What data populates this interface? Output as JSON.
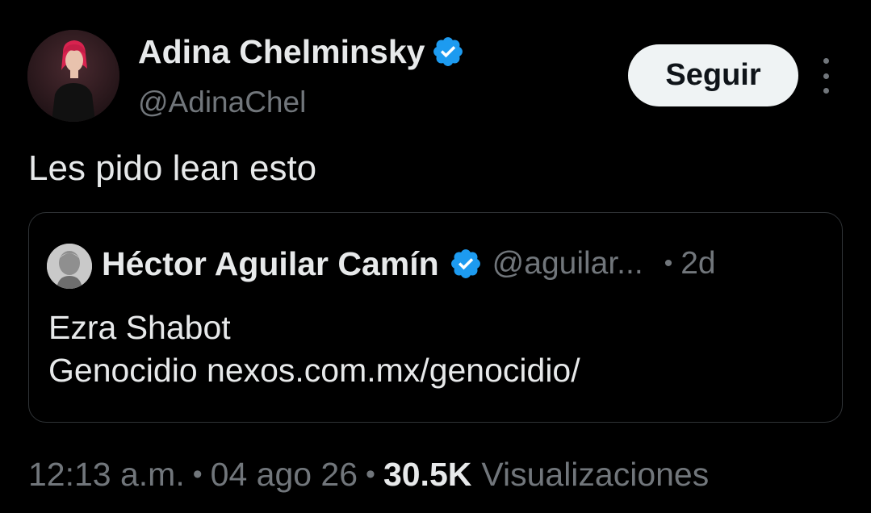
{
  "author": {
    "name": "Adina Chelminsky",
    "handle": "@AdinaChel",
    "verified_icon": "verified-badge-icon",
    "follow_label": "Seguir",
    "more_icon": "more-options-icon"
  },
  "tweet": {
    "text": "Les pido lean esto"
  },
  "quoted": {
    "name": "Héctor Aguilar Camín",
    "handle": "@aguilar...",
    "dot": "•",
    "time": "2d",
    "line1": "Ezra Shabot",
    "line2": "Genocidio nexos.com.mx/genocidio/"
  },
  "meta": {
    "time": "12:13 a.m.",
    "sep": "•",
    "date": "04 ago 26",
    "views_count": "30.5K",
    "views_label": "Visualizaciones"
  },
  "colors": {
    "background": "#000000",
    "text": "#e7e9ea",
    "muted": "#71767b",
    "verified": "#1d9bf0",
    "border": "#2f3336"
  }
}
